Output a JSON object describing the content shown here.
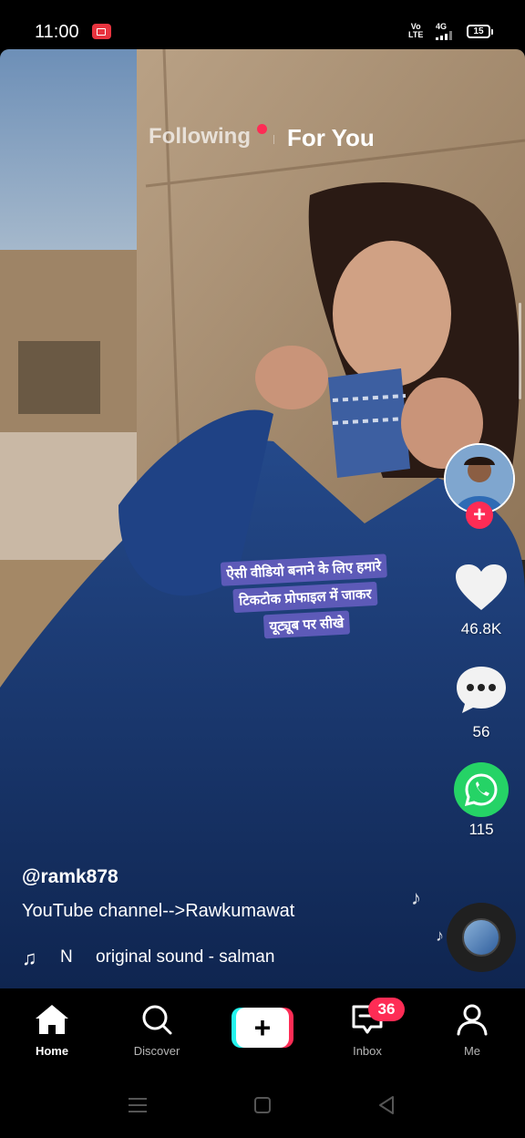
{
  "status_bar": {
    "time": "11:00",
    "volte_top": "Vo",
    "volte_bottom": "LTE",
    "network": "4G",
    "battery": "15"
  },
  "top_tabs": {
    "following": "Following",
    "for_you": "For You"
  },
  "video": {
    "caption_lines": [
      "ऐसी वीडियो बनाने के लिए हमारे",
      "टिकटोक प्रोफाइल में जाकर",
      "यूट्यूब पर सीखे"
    ]
  },
  "actions": {
    "likes": "46.8K",
    "comments": "56",
    "shares": "115"
  },
  "post": {
    "username": "@ramk878",
    "description": "YouTube channel-->Rawkumawat",
    "sound_prefix": "N",
    "sound_name": "original sound - salman"
  },
  "bottom_nav": {
    "home": "Home",
    "discover": "Discover",
    "inbox": "Inbox",
    "inbox_badge": "36",
    "me": "Me"
  },
  "colors": {
    "accent_red": "#fe2c55",
    "accent_cyan": "#25f4ee",
    "whatsapp_green": "#25d366",
    "caption_bg": "#5d5ab8"
  }
}
